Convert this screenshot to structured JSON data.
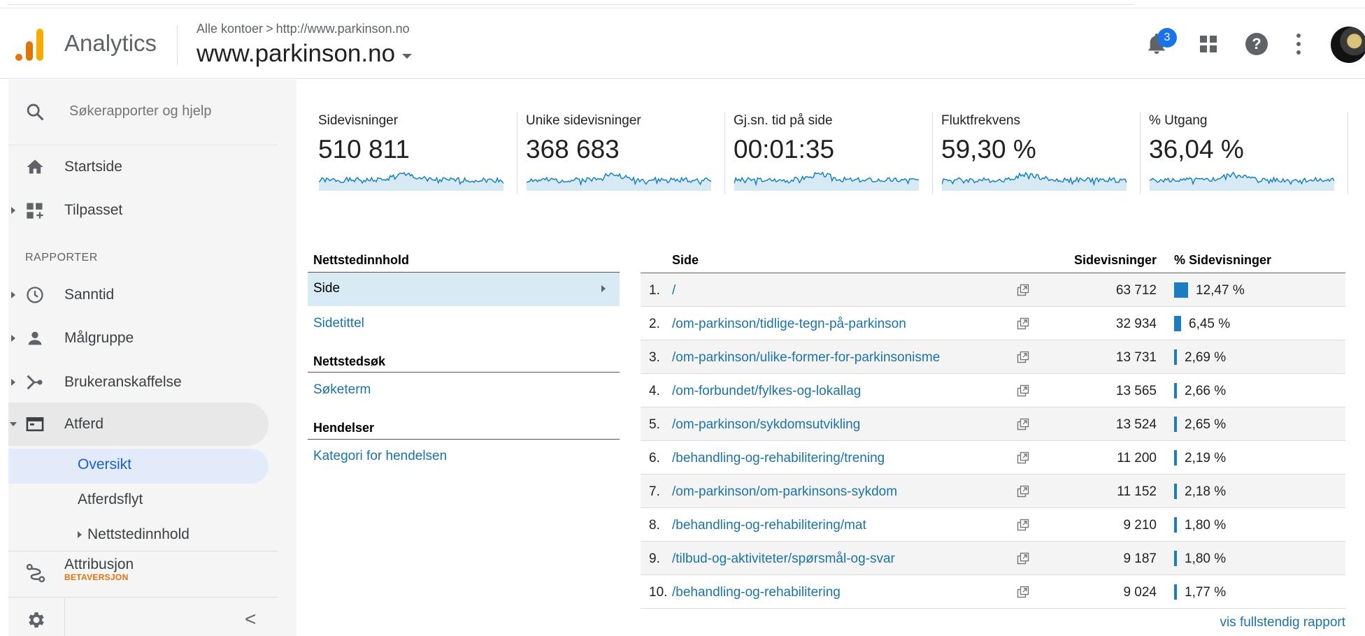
{
  "header": {
    "app_title": "Analytics",
    "breadcrumb_root": "Alle kontoer",
    "breadcrumb_sep": ">",
    "breadcrumb_url": "http://www.parkinson.no",
    "property": "www.parkinson.no",
    "notification_count": "3"
  },
  "sidebar": {
    "search_placeholder": "Søkerapporter og hjelp",
    "startside": "Startside",
    "tilpasset": "Tilpasset",
    "section_reports": "RAPPORTER",
    "sanntid": "Sanntid",
    "malgruppe": "Målgruppe",
    "brukeranskaffelse": "Brukeranskaffelse",
    "atferd": "Atferd",
    "oversikt": "Oversikt",
    "atferdsflyt": "Atferdsflyt",
    "nettstedinnhold": "Nettstedinnhold",
    "attribusjon": "Attribusjon",
    "attribusjon_beta": "BETAVERSJON",
    "collapse": "<"
  },
  "metrics": [
    {
      "label": "Sidevisninger",
      "value": "510 811"
    },
    {
      "label": "Unike sidevisninger",
      "value": "368 683"
    },
    {
      "label": "Gj.sn. tid på side",
      "value": "00:01:35"
    },
    {
      "label": "Fluktfrekvens",
      "value": "59,30 %"
    },
    {
      "label": "% Utgang",
      "value": "36,04 %"
    }
  ],
  "content_table": {
    "group1": "Nettstedinnhold",
    "side": "Side",
    "sidetittel": "Sidetittel",
    "group2": "Nettstedsøk",
    "soketerm": "Søketerm",
    "group3": "Hendelser",
    "kategori": "Kategori for hendelsen"
  },
  "pages_table": {
    "col_side": "Side",
    "col_views": "Sidevisninger",
    "col_pct": "% Sidevisninger",
    "rows": [
      {
        "num": "1.",
        "path": "/",
        "views": "63 712",
        "pct": "12,47 %",
        "share": 0.1247
      },
      {
        "num": "2.",
        "path": "/om-parkinson/tidlige-tegn-på-parkinson",
        "views": "32 934",
        "pct": "6,45 %",
        "share": 0.0645
      },
      {
        "num": "3.",
        "path": "/om-parkinson/ulike-former-for-parkinsonisme",
        "views": "13 731",
        "pct": "2,69 %",
        "share": 0.0269
      },
      {
        "num": "4.",
        "path": "/om-forbundet/fylkes-og-lokallag",
        "views": "13 565",
        "pct": "2,66 %",
        "share": 0.0266
      },
      {
        "num": "5.",
        "path": "/om-parkinson/sykdomsutvikling",
        "views": "13 524",
        "pct": "2,65 %",
        "share": 0.0265
      },
      {
        "num": "6.",
        "path": "/behandling-og-rehabilitering/trening",
        "views": "11 200",
        "pct": "2,19 %",
        "share": 0.0219
      },
      {
        "num": "7.",
        "path": "/om-parkinson/om-parkinsons-sykdom",
        "views": "11 152",
        "pct": "2,18 %",
        "share": 0.0218
      },
      {
        "num": "8.",
        "path": "/behandling-og-rehabilitering/mat",
        "views": "9 210",
        "pct": "1,80 %",
        "share": 0.018
      },
      {
        "num": "9.",
        "path": "/tilbud-og-aktiviteter/spørsmål-og-svar",
        "views": "9 187",
        "pct": "1,80 %",
        "share": 0.018
      },
      {
        "num": "10.",
        "path": "/behandling-og-rehabilitering",
        "views": "9 024",
        "pct": "1,77 %",
        "share": 0.0177
      }
    ],
    "full_report_link": "vis fullstendig rapport"
  },
  "colors": {
    "accent": "#1a73a8",
    "bar": "#1a7dc4",
    "spark": "#0b7cbf",
    "logo_orange": "#E37400",
    "logo_yellow": "#F9AB00",
    "beta": "#e8710a"
  }
}
